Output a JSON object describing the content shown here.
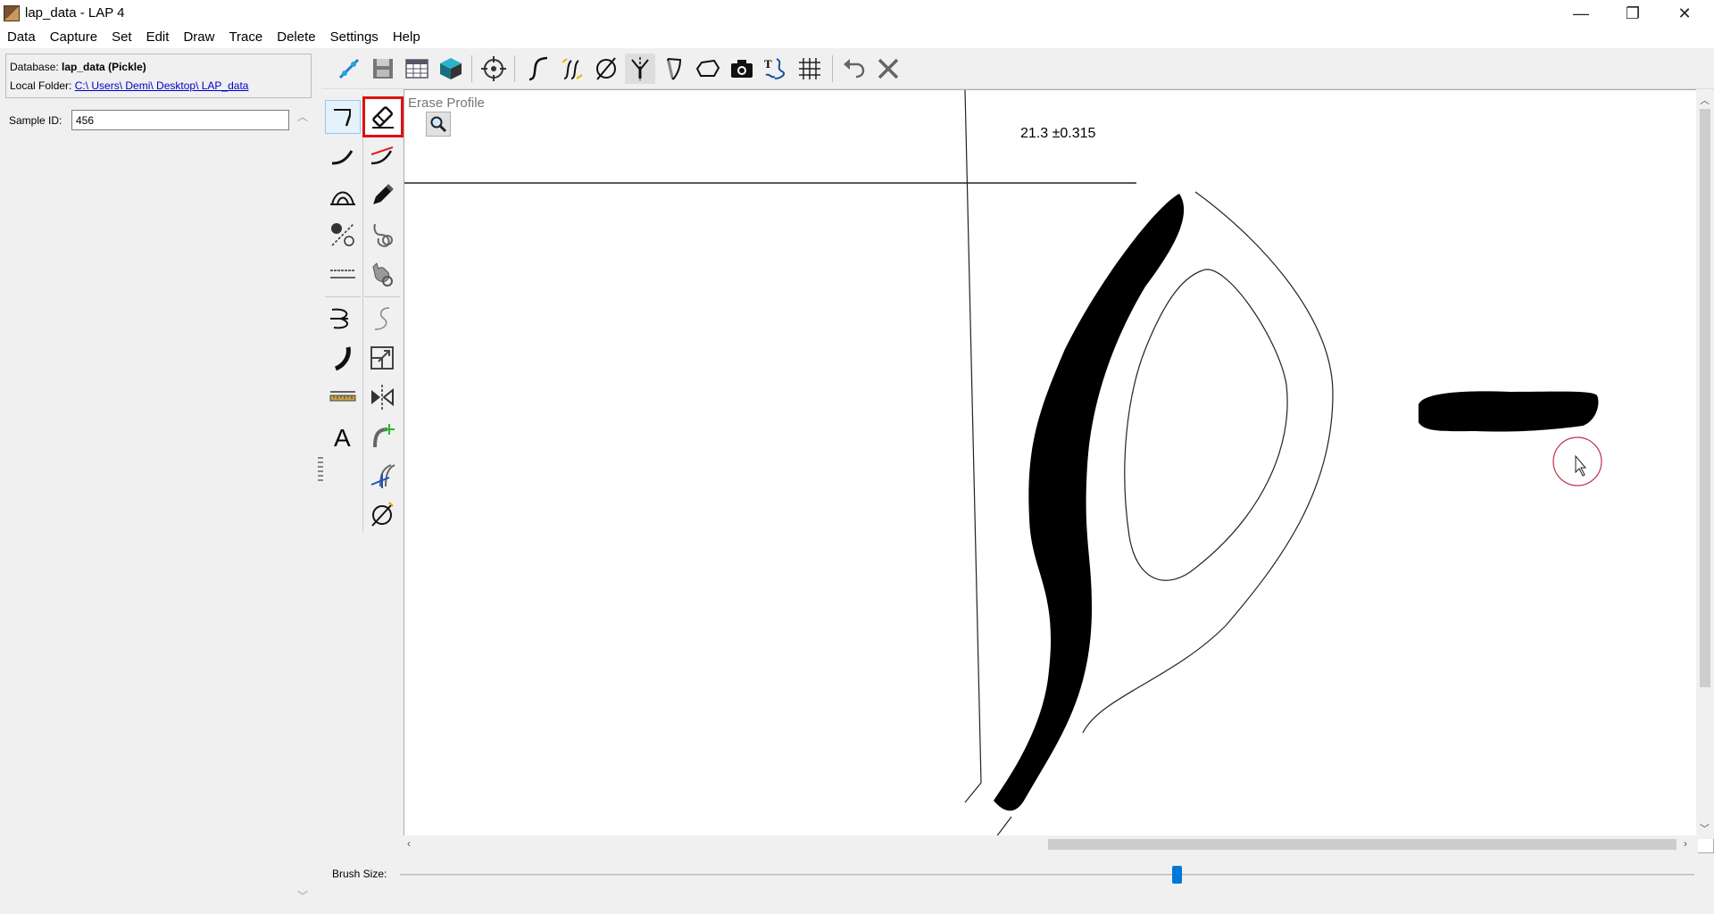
{
  "window": {
    "title": "lap_data - LAP 4",
    "controls": {
      "minimize": "—",
      "maximize": "❐",
      "close": "✕"
    }
  },
  "menu": [
    "Data",
    "Capture",
    "Set",
    "Edit",
    "Draw",
    "Trace",
    "Delete",
    "Settings",
    "Help"
  ],
  "database": {
    "label": "Database:",
    "value": "lap_data (Pickle)",
    "folder_label": "Local Folder:",
    "folder_value": "C:\\ Users\\ Demi\\ Desktop\\ LAP_data"
  },
  "sample": {
    "label": "Sample ID:",
    "value": "456"
  },
  "toolbar_icons": [
    "connect-icon",
    "save-icon",
    "table-icon",
    "cube-icon",
    "target-icon",
    "curve-icon",
    "double-curve-icon",
    "diameter-icon",
    "axis-icon",
    "section-icon",
    "polygon-icon",
    "camera-icon",
    "text-trace-icon",
    "grid-icon",
    "undo-icon",
    "close-icon"
  ],
  "left_tools": [
    "profile-corner-icon",
    "rim-curve-icon",
    "arch-icon",
    "point-line-icon",
    "dashed-line-icon",
    "split-curve-icon",
    "brush-curve-icon",
    "ruler-icon",
    "text-tool-icon"
  ],
  "right_tools": [
    "erase-profile-icon",
    "red-curve-icon",
    "pencil-icon",
    "handle-icon",
    "cat-handle-icon",
    "s-curve-icon",
    "scale-icon",
    "mirror-icon",
    "add-curve-icon",
    "blue-curve-icon",
    "diameter-orange-icon"
  ],
  "canvas": {
    "mode_label": "Erase Profile",
    "measurement": "21.3 ±0.315"
  },
  "brush": {
    "label": "Brush Size:",
    "level_fraction": 0.6
  },
  "colors": {
    "highlight": "#e01010",
    "accent": "#0078d7",
    "link": "#0000cc"
  }
}
